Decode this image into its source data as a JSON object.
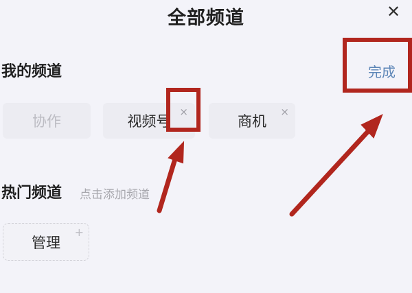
{
  "header": {
    "title": "全部频道",
    "close_symbol": "✕"
  },
  "my_channels": {
    "title": "我的频道",
    "done_label": "完成",
    "items": [
      {
        "label": "协作",
        "removable": false
      },
      {
        "label": "视频号",
        "removable": true,
        "remove_symbol": "×"
      },
      {
        "label": "商机",
        "removable": true,
        "remove_symbol": "×"
      }
    ]
  },
  "hot_channels": {
    "title": "热门频道",
    "hint": "点击添加频道",
    "items": [
      {
        "label": "管理",
        "add_symbol": "+"
      }
    ]
  },
  "annotation": {
    "color": "#b1261e"
  }
}
